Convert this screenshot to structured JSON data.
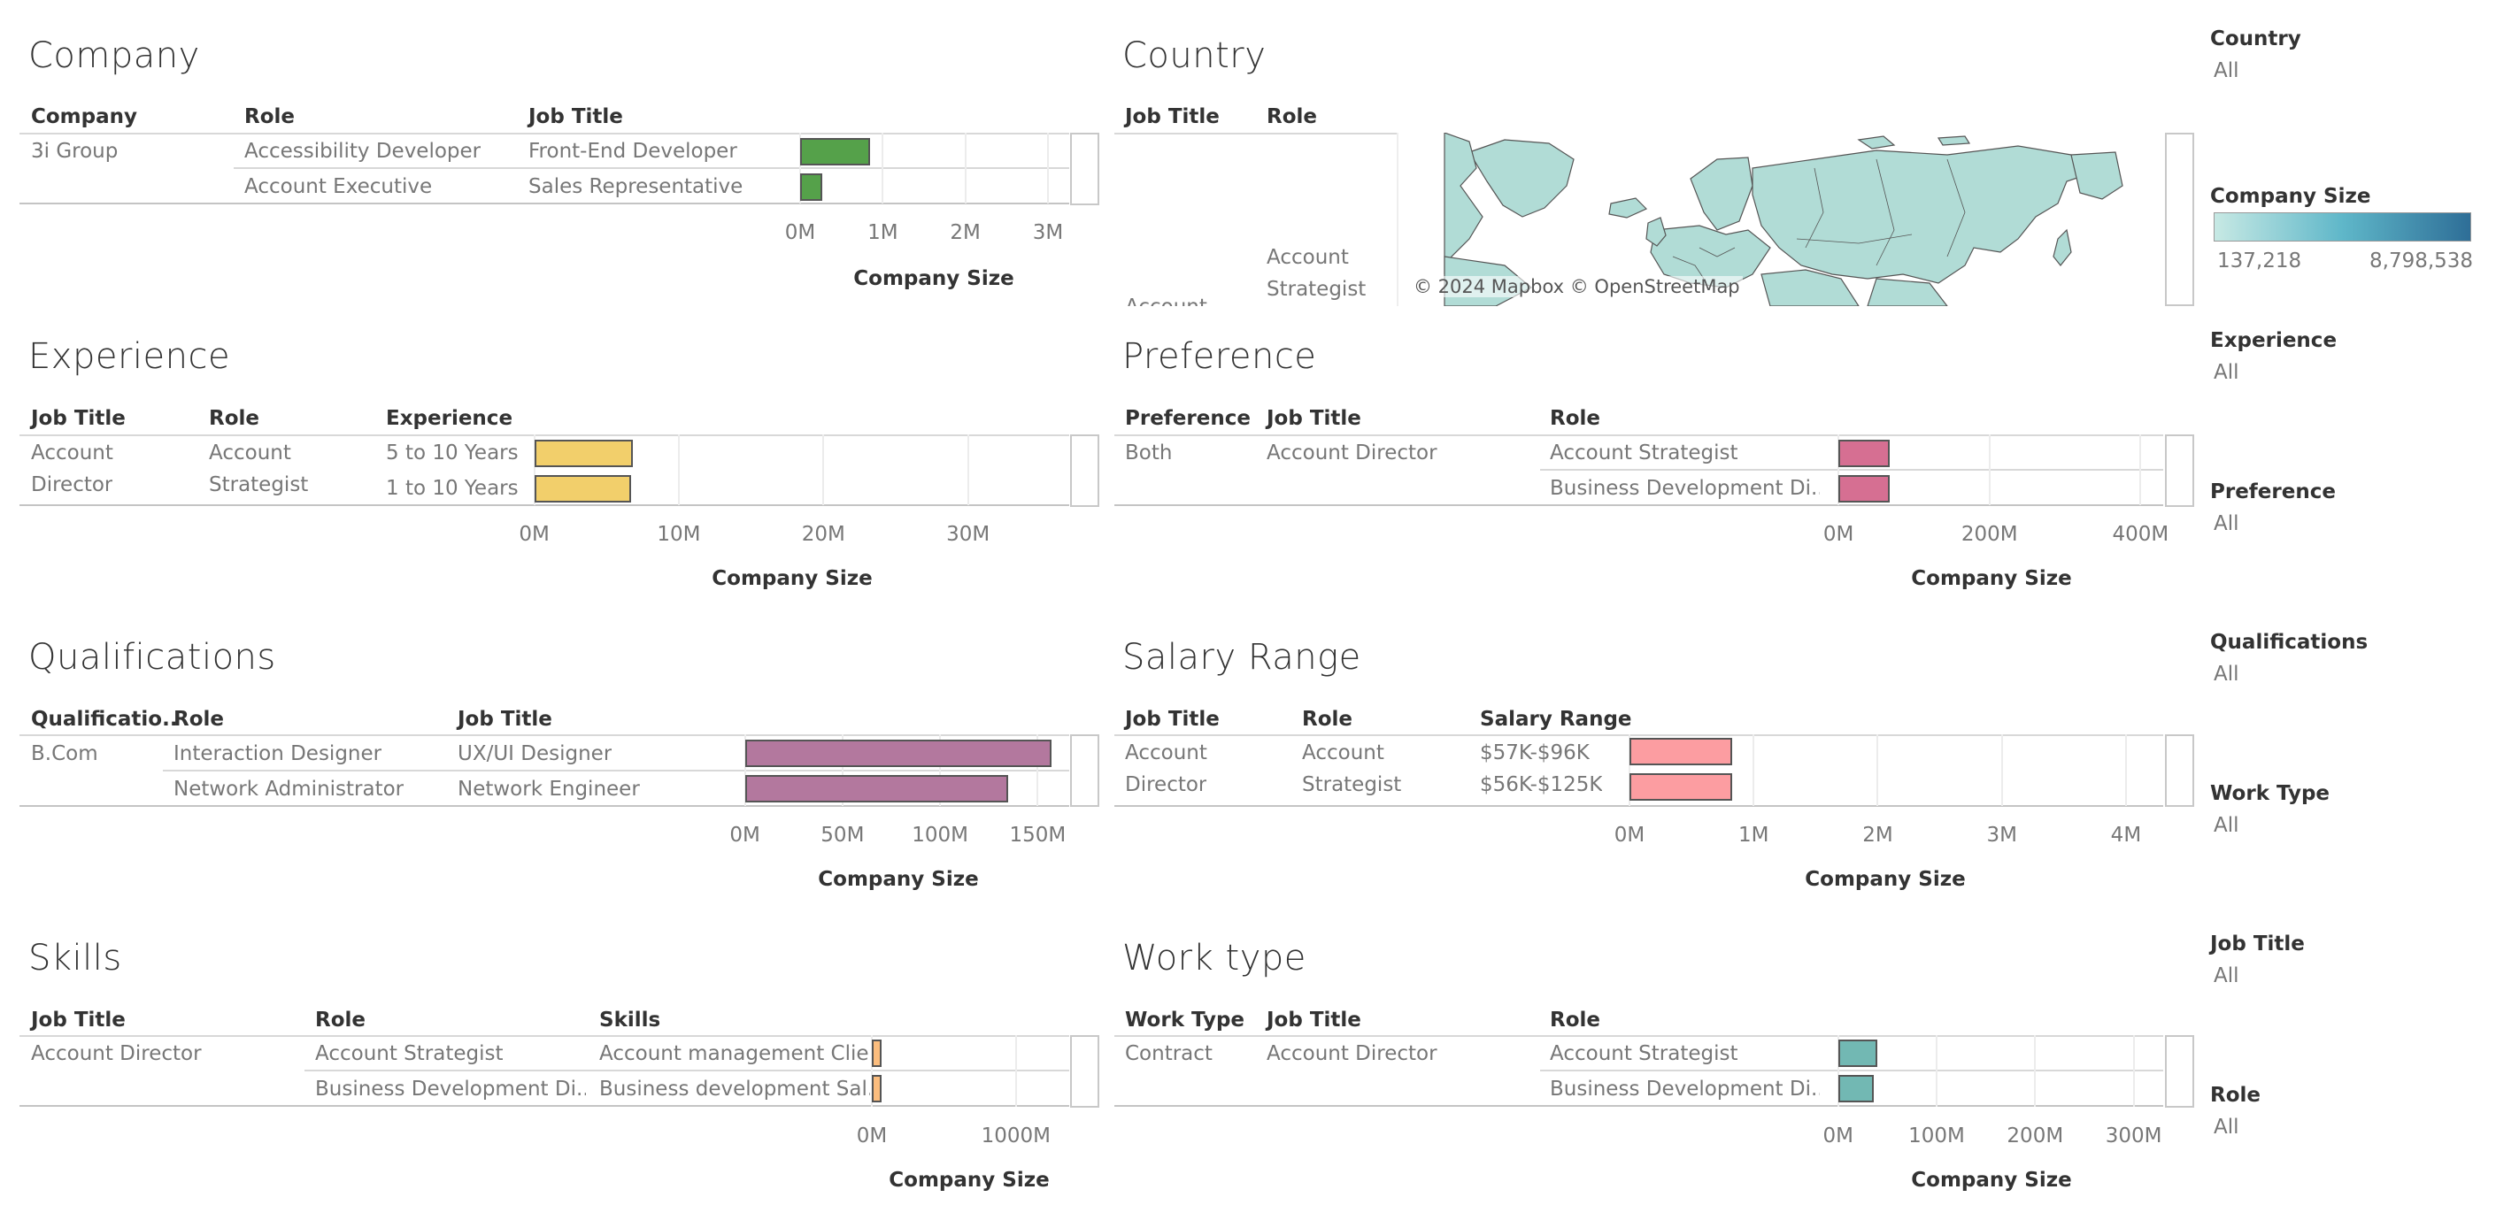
{
  "colors": {
    "company": "#55a14a",
    "experience": "#f2cf6b",
    "qualifications": "#b3789e",
    "preference": "#d66f92",
    "salary": "#fc9da1",
    "skills": "#fbbd7e",
    "worktype": "#72b8b3",
    "map_fill": "#b1dcd6",
    "legend_low": "#c7e9e4",
    "legend_high": "#2e6e97"
  },
  "panels": {
    "company": {
      "title": "Company",
      "headers": [
        "Company",
        "Role",
        "Job Title"
      ],
      "rows": [
        {
          "c1": "3i Group",
          "c2": "Accessibility Developer",
          "c3": "Front-End Developer"
        },
        {
          "c1": "",
          "c2": "Account Executive",
          "c3": "Sales Representative"
        }
      ],
      "axis_title": "Company Size",
      "chart_data": {
        "type": "bar",
        "orientation": "horizontal",
        "categories": [
          "Accessibility Developer",
          "Account Executive"
        ],
        "values": [
          850000,
          270000
        ],
        "xlim": [
          0,
          3300000
        ],
        "ticks": [
          0,
          1000000,
          2000000,
          3000000
        ],
        "tick_labels": [
          "0M",
          "1M",
          "2M",
          "3M"
        ],
        "xlabel": "Company Size"
      }
    },
    "country": {
      "title": "Country",
      "headers": [
        "Job Title",
        "Role"
      ],
      "row_role": [
        "Account",
        "Strategist"
      ],
      "row_job_title_partial": "Account",
      "credit": "© 2024 Mapbox © OpenStreetMap"
    },
    "experience": {
      "title": "Experience",
      "headers": [
        "Job Title",
        "Role",
        "Experience"
      ],
      "row_job_title": [
        "Account",
        "Director"
      ],
      "row_role": [
        "Account",
        "Strategist"
      ],
      "rows": [
        "5 to 10 Years",
        "1 to 10 Years"
      ],
      "axis_title": "Company Size",
      "chart_data": {
        "type": "bar",
        "orientation": "horizontal",
        "categories": [
          "5 to 10 Years",
          "1 to 10 Years"
        ],
        "values": [
          6800000,
          6700000
        ],
        "xlim": [
          -1200000,
          37000000
        ],
        "ticks": [
          0,
          10000000,
          20000000,
          30000000
        ],
        "tick_labels": [
          "0M",
          "10M",
          "20M",
          "30M"
        ],
        "xlabel": "Company Size"
      }
    },
    "preference": {
      "title": "Preference",
      "headers": [
        "Preference",
        "Job Title",
        "Role"
      ],
      "rows": [
        {
          "c1": "Both",
          "c2": "Account Director",
          "c3": "Account Strategist"
        },
        {
          "c1": "",
          "c2": "",
          "c3": "Business Development Di.."
        }
      ],
      "axis_title": "Company Size",
      "chart_data": {
        "type": "bar",
        "orientation": "horizontal",
        "categories": [
          "Account Strategist",
          "Business Development Di.."
        ],
        "values": [
          68000000,
          68000000
        ],
        "xlim": [
          -20000000,
          430000000
        ],
        "ticks": [
          0,
          200000000,
          400000000
        ],
        "tick_labels": [
          "0M",
          "200M",
          "400M"
        ],
        "xlabel": "Company Size"
      }
    },
    "qualifications": {
      "title": "Qualifications",
      "headers": [
        "Qualificatio..",
        "Role",
        "Job Title"
      ],
      "rows": [
        {
          "c1": "B.Com",
          "c2": "Interaction Designer",
          "c3": "UX/UI Designer"
        },
        {
          "c1": "",
          "c2": "Network Administrator",
          "c3": "Network Engineer"
        }
      ],
      "axis_title": "Company Size",
      "chart_data": {
        "type": "bar",
        "orientation": "horizontal",
        "categories": [
          "UX/UI Designer",
          "Network Engineer"
        ],
        "values": [
          157000000,
          135000000
        ],
        "xlim": [
          -8000000,
          168000000
        ],
        "ticks": [
          0,
          50000000,
          100000000,
          150000000
        ],
        "tick_labels": [
          "0M",
          "50M",
          "100M",
          "150M"
        ],
        "xlabel": "Company Size"
      }
    },
    "salary": {
      "title": "Salary Range",
      "headers": [
        "Job Title",
        "Role",
        "Salary Range"
      ],
      "row_job_title": [
        "Account",
        "Director"
      ],
      "row_role": [
        "Account",
        "Strategist"
      ],
      "rows": [
        "$57K-$96K",
        "$56K-$125K"
      ],
      "axis_title": "Company Size",
      "chart_data": {
        "type": "bar",
        "orientation": "horizontal",
        "categories": [
          "$57K-$96K",
          "$56K-$125K"
        ],
        "values": [
          830000,
          830000
        ],
        "xlim": [
          -150000,
          4300000
        ],
        "ticks": [
          0,
          1000000,
          2000000,
          3000000,
          4000000
        ],
        "tick_labels": [
          "0M",
          "1M",
          "2M",
          "3M",
          "4M"
        ],
        "xlabel": "Company Size"
      }
    },
    "skills": {
      "title": "Skills",
      "headers": [
        "Job Title",
        "Role",
        "Skills"
      ],
      "rows": [
        {
          "c1": "Account Director",
          "c2": "Account Strategist",
          "c3": "Account management Clie.."
        },
        {
          "c1": "",
          "c2": "Business Development Di..",
          "c3": "Business development Sal.."
        }
      ],
      "axis_title": "Company Size",
      "chart_data": {
        "type": "bar",
        "orientation": "horizontal",
        "categories": [
          "Account management Clie..",
          "Business development Sal.."
        ],
        "values": [
          67000000,
          67000000
        ],
        "xlim": [
          0,
          1370000000
        ],
        "ticks": [
          0,
          1000000000
        ],
        "tick_labels": [
          "0M",
          "1000M"
        ],
        "xlabel": "Company Size"
      }
    },
    "worktype": {
      "title": "Work type",
      "headers": [
        "Work Type",
        "Job Title",
        "Role"
      ],
      "rows": [
        {
          "c1": "Contract",
          "c2": "Account Director",
          "c3": "Account Strategist"
        },
        {
          "c1": "",
          "c2": "",
          "c3": "Business Development Di.."
        }
      ],
      "axis_title": "Company Size",
      "chart_data": {
        "type": "bar",
        "orientation": "horizontal",
        "categories": [
          "Account Strategist",
          "Business Development Di.."
        ],
        "values": [
          40000000,
          36000000
        ],
        "xlim": [
          -15000000,
          330000000
        ],
        "ticks": [
          0,
          100000000,
          200000000,
          300000000
        ],
        "tick_labels": [
          "0M",
          "100M",
          "200M",
          "300M"
        ],
        "xlabel": "Company Size"
      }
    }
  },
  "filters": [
    {
      "label": "Country",
      "value": "All"
    },
    {
      "label": "Experience",
      "value": "All"
    },
    {
      "label": "Preference",
      "value": "All"
    },
    {
      "label": "Qualifications",
      "value": "All"
    },
    {
      "label": "Work Type",
      "value": "All"
    },
    {
      "label": "Job Title",
      "value": "All"
    },
    {
      "label": "Role",
      "value": "All"
    }
  ],
  "legend": {
    "title": "Company Size",
    "min_label": "137,218",
    "max_label": "8,798,538"
  }
}
